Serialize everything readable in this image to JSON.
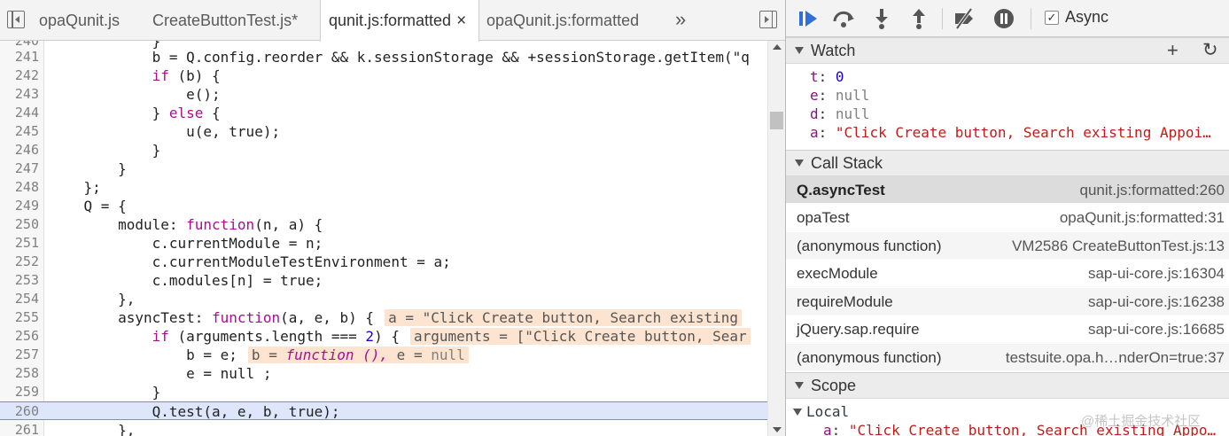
{
  "tabs": [
    {
      "label": "opaQunit.js"
    },
    {
      "label": "CreateButtonTest.js*"
    },
    {
      "label": "qunit.js:formatted",
      "close": "×"
    },
    {
      "label": "opaQunit.js:formatted"
    }
  ],
  "more_tabs": "»",
  "code_lines": [
    {
      "ln": "240",
      "text": "            }"
    },
    {
      "ln": "241",
      "text": "            b = Q.config.reorder && k.sessionStorage && +sessionStorage.getItem(\"q"
    },
    {
      "ln": "242",
      "text": "            if (b) {"
    },
    {
      "ln": "243",
      "text": "                e();"
    },
    {
      "ln": "244",
      "text": "            } else {"
    },
    {
      "ln": "245",
      "text": "                u(e, true);"
    },
    {
      "ln": "246",
      "text": "            }"
    },
    {
      "ln": "247",
      "text": "        }"
    },
    {
      "ln": "248",
      "text": "    };"
    },
    {
      "ln": "249",
      "text": "    Q = {"
    },
    {
      "ln": "250",
      "text": "        module: function(n, a) {"
    },
    {
      "ln": "251",
      "text": "            c.currentModule = n;"
    },
    {
      "ln": "252",
      "text": "            c.currentModuleTestEnvironment = a;"
    },
    {
      "ln": "253",
      "text": "            c.modules[n] = true;"
    },
    {
      "ln": "254",
      "text": "        },"
    },
    {
      "ln": "255",
      "text": "        asyncTest: function(a, e, b) {"
    },
    {
      "ln": "256",
      "text": "            if (arguments.length === 2) {"
    },
    {
      "ln": "257",
      "text": "                b = e;"
    },
    {
      "ln": "258",
      "text": "                e = null ;"
    },
    {
      "ln": "259",
      "text": "            }"
    },
    {
      "ln": "260",
      "text": "            Q.test(a, e, b, true);"
    },
    {
      "ln": "261",
      "text": "        },"
    }
  ],
  "inline_values": {
    "line255": "a = \"Click Create button, Search existing",
    "line256": "arguments = [\"Click Create button, Sear",
    "line257_b": "b = ",
    "line257_fn": "function (),",
    "line257_e": " e = ",
    "line257_null": "null"
  },
  "debugger": {
    "async_label": "Async",
    "async_checked": "✓",
    "watch": {
      "title": "Watch",
      "add": "+",
      "refresh": "↻",
      "items": [
        {
          "name": "t",
          "value": "0"
        },
        {
          "name": "e",
          "value": "null"
        },
        {
          "name": "d",
          "value": "null"
        },
        {
          "name": "a",
          "value": "\"Click Create button, Search existing Appoi…"
        }
      ]
    },
    "call_stack": {
      "title": "Call Stack",
      "frames": [
        {
          "fn": "Q.asyncTest",
          "loc": "qunit.js:formatted:260"
        },
        {
          "fn": "opaTest",
          "loc": "opaQunit.js:formatted:31"
        },
        {
          "fn": "(anonymous function)",
          "loc": "VM2586 CreateButtonTest.js:13"
        },
        {
          "fn": "execModule",
          "loc": "sap-ui-core.js:16304"
        },
        {
          "fn": "requireModule",
          "loc": "sap-ui-core.js:16238"
        },
        {
          "fn": "jQuery.sap.require",
          "loc": "sap-ui-core.js:16685"
        },
        {
          "fn": "(anonymous function)",
          "loc": "testsuite.opa.h…nderOn=true:37"
        }
      ]
    },
    "scope": {
      "title": "Scope",
      "local_label": "Local",
      "a_name": "a",
      "a_value": "\"Click Create button, Search existing Appo…"
    }
  },
  "watermark": "@稀土掘金技术社区"
}
